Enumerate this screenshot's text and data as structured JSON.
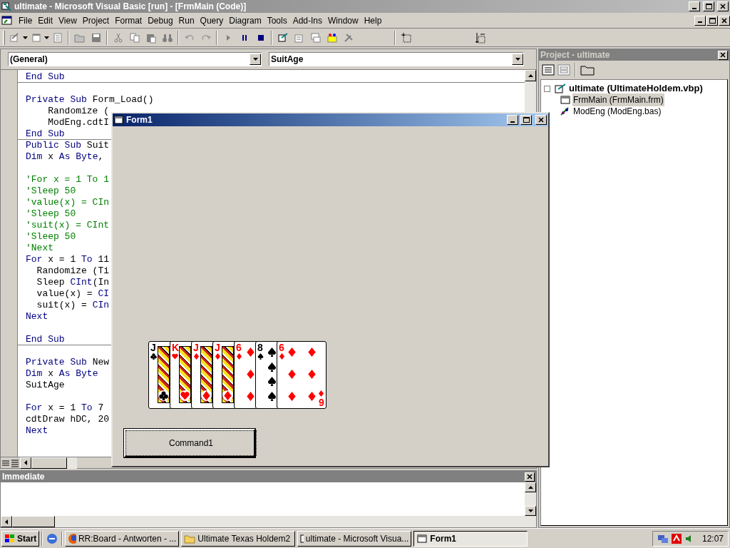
{
  "window": {
    "title": "ultimate - Microsoft Visual Basic [run] - [FrmMain (Code)]"
  },
  "menu": [
    "File",
    "Edit",
    "View",
    "Project",
    "Format",
    "Debug",
    "Run",
    "Query",
    "Diagram",
    "Tools",
    "Add-Ins",
    "Window",
    "Help"
  ],
  "code_window": {
    "object_combo": "(General)",
    "procedure_combo": "SuitAge",
    "lines": [
      {
        "kind": "code",
        "procedure_end": true,
        "segments": [
          {
            "kind": "keyword",
            "text": "End Sub"
          }
        ]
      },
      {
        "kind": "blank"
      },
      {
        "kind": "code",
        "procedure_end": false,
        "segments": [
          {
            "kind": "keyword",
            "text": "Private Sub "
          },
          {
            "kind": "plain",
            "text": "Form_Load()"
          }
        ]
      },
      {
        "kind": "code",
        "procedure_end": false,
        "segments": [
          {
            "kind": "plain",
            "text": "    Randomize ("
          }
        ]
      },
      {
        "kind": "code",
        "procedure_end": false,
        "segments": [
          {
            "kind": "plain",
            "text": "    ModEng.cdtI"
          }
        ]
      },
      {
        "kind": "code",
        "procedure_end": true,
        "segments": [
          {
            "kind": "keyword",
            "text": "End Sub"
          }
        ]
      },
      {
        "kind": "code",
        "procedure_end": false,
        "segments": [
          {
            "kind": "keyword",
            "text": "Public Sub "
          },
          {
            "kind": "plain",
            "text": "Suit"
          }
        ]
      },
      {
        "kind": "code",
        "procedure_end": false,
        "segments": [
          {
            "kind": "keyword",
            "text": "Dim "
          },
          {
            "kind": "plain",
            "text": "x "
          },
          {
            "kind": "keyword",
            "text": "As Byte"
          },
          {
            "kind": "plain",
            "text": ","
          }
        ]
      },
      {
        "kind": "blank"
      },
      {
        "kind": "code",
        "procedure_end": false,
        "segments": [
          {
            "kind": "comment",
            "text": "'For x = 1 To 1"
          }
        ]
      },
      {
        "kind": "code",
        "procedure_end": false,
        "segments": [
          {
            "kind": "comment",
            "text": "'Sleep 50"
          }
        ]
      },
      {
        "kind": "code",
        "procedure_end": false,
        "segments": [
          {
            "kind": "comment",
            "text": "'value(x) = CIn"
          }
        ]
      },
      {
        "kind": "code",
        "procedure_end": false,
        "segments": [
          {
            "kind": "comment",
            "text": "'Sleep 50"
          }
        ]
      },
      {
        "kind": "code",
        "procedure_end": false,
        "segments": [
          {
            "kind": "comment",
            "text": "'suit(x) = CInt"
          }
        ]
      },
      {
        "kind": "code",
        "procedure_end": false,
        "segments": [
          {
            "kind": "comment",
            "text": "'Sleep 50"
          }
        ]
      },
      {
        "kind": "code",
        "procedure_end": false,
        "segments": [
          {
            "kind": "comment",
            "text": "'Next"
          }
        ]
      },
      {
        "kind": "code",
        "procedure_end": false,
        "segments": [
          {
            "kind": "keyword",
            "text": "For "
          },
          {
            "kind": "plain",
            "text": "x = 1 "
          },
          {
            "kind": "keyword",
            "text": "To "
          },
          {
            "kind": "plain",
            "text": "11"
          }
        ]
      },
      {
        "kind": "code",
        "procedure_end": false,
        "segments": [
          {
            "kind": "plain",
            "text": "  Randomize (Ti"
          }
        ]
      },
      {
        "kind": "code",
        "procedure_end": false,
        "segments": [
          {
            "kind": "plain",
            "text": "  Sleep "
          },
          {
            "kind": "keyword",
            "text": "CInt"
          },
          {
            "kind": "plain",
            "text": "(In"
          }
        ]
      },
      {
        "kind": "code",
        "procedure_end": false,
        "segments": [
          {
            "kind": "plain",
            "text": "  value(x) = "
          },
          {
            "kind": "keyword",
            "text": "CI"
          }
        ]
      },
      {
        "kind": "code",
        "procedure_end": false,
        "segments": [
          {
            "kind": "plain",
            "text": "  suit(x) = "
          },
          {
            "kind": "keyword",
            "text": "CIn"
          }
        ]
      },
      {
        "kind": "code",
        "procedure_end": false,
        "segments": [
          {
            "kind": "keyword",
            "text": "Next"
          }
        ]
      },
      {
        "kind": "blank"
      },
      {
        "kind": "code",
        "procedure_end": true,
        "segments": [
          {
            "kind": "keyword",
            "text": "End Sub"
          }
        ]
      },
      {
        "kind": "blank"
      },
      {
        "kind": "code",
        "procedure_end": false,
        "segments": [
          {
            "kind": "keyword",
            "text": "Private Sub "
          },
          {
            "kind": "plain",
            "text": "New"
          }
        ]
      },
      {
        "kind": "code",
        "procedure_end": false,
        "segments": [
          {
            "kind": "keyword",
            "text": "Dim "
          },
          {
            "kind": "plain",
            "text": "x "
          },
          {
            "kind": "keyword",
            "text": "As Byte"
          }
        ]
      },
      {
        "kind": "code",
        "procedure_end": false,
        "segments": [
          {
            "kind": "plain",
            "text": "SuitAge"
          }
        ]
      },
      {
        "kind": "blank"
      },
      {
        "kind": "code",
        "procedure_end": false,
        "segments": [
          {
            "kind": "keyword",
            "text": "For "
          },
          {
            "kind": "plain",
            "text": "x = 1 "
          },
          {
            "kind": "keyword",
            "text": "To "
          },
          {
            "kind": "plain",
            "text": "7"
          }
        ]
      },
      {
        "kind": "code",
        "procedure_end": false,
        "segments": [
          {
            "kind": "plain",
            "text": "cdtDraw hDC, 20"
          }
        ]
      },
      {
        "kind": "code",
        "procedure_end": false,
        "segments": [
          {
            "kind": "keyword",
            "text": "Next"
          }
        ]
      }
    ]
  },
  "form": {
    "title": "Form1",
    "cards": [
      {
        "rank": "J",
        "kind": "club",
        "face": true,
        "color": "#000000"
      },
      {
        "rank": "K",
        "kind": "heart",
        "face": true,
        "color": "#ff0000"
      },
      {
        "rank": "J",
        "kind": "diamond",
        "face": true,
        "color": "#ff0000"
      },
      {
        "rank": "J",
        "kind": "diamond",
        "face": true,
        "color": "#ff0000"
      },
      {
        "rank": "6",
        "kind": "diamond",
        "face": false,
        "color": "#ff0000"
      },
      {
        "rank": "8",
        "kind": "spade",
        "face": false,
        "color": "#000000"
      },
      {
        "rank": "6",
        "kind": "diamond",
        "face": false,
        "color": "#ff0000",
        "bottom_rank": "6"
      }
    ],
    "button": "Command1"
  },
  "project": {
    "title": "Project - ultimate",
    "tree": [
      {
        "label": "ultimate (UltimateHoldem.vbp)",
        "kind": "project",
        "selected": false,
        "children": [
          {
            "label": "FrmMain (FrmMain.frm)",
            "kind": "form",
            "selected": true
          },
          {
            "label": "ModEng (ModEng.bas)",
            "kind": "module",
            "selected": false
          }
        ]
      }
    ]
  },
  "immediate": {
    "title": "Immediate"
  },
  "taskbar": {
    "start": "Start",
    "tasks": [
      {
        "label": "RR:Board - Antworten - ...",
        "kind": "browser",
        "selected": false
      },
      {
        "label": "Ultimate Texas Holdem2",
        "kind": "folder",
        "selected": false
      },
      {
        "label": "ultimate - Microsoft Visua...",
        "kind": "vb",
        "selected": false
      },
      {
        "label": "Form1",
        "kind": "form",
        "selected": true
      }
    ],
    "clock": "12:07"
  }
}
